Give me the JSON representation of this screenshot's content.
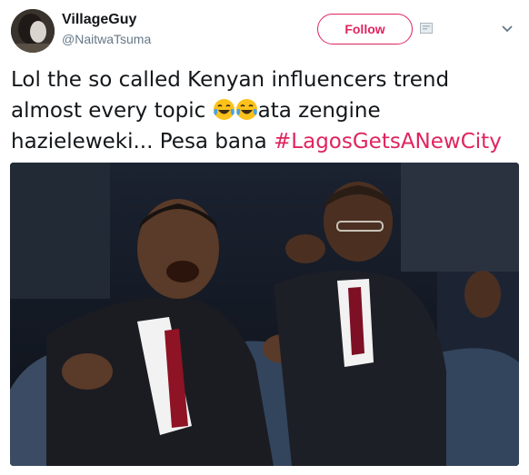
{
  "tweet": {
    "display_name": "VillageGuy",
    "handle": "@NaitwaTsuma",
    "follow_label": "Follow",
    "text_part1": "Lol the so called Kenyan influencers trend almost every topic ",
    "text_part2": "ata zengine hazieleweki... Pesa bana ",
    "hashtag": "#LagosGetsANewCity",
    "emoji": [
      "face-with-tears-of-joy-icon",
      "face-with-tears-of-joy-icon"
    ]
  },
  "colors": {
    "accent": "#e0245e",
    "text": "#14171a",
    "secondary_text": "#657786"
  },
  "icons": {
    "follow_icon": "person-add-icon",
    "menu_icon": "chevron-down-icon"
  }
}
